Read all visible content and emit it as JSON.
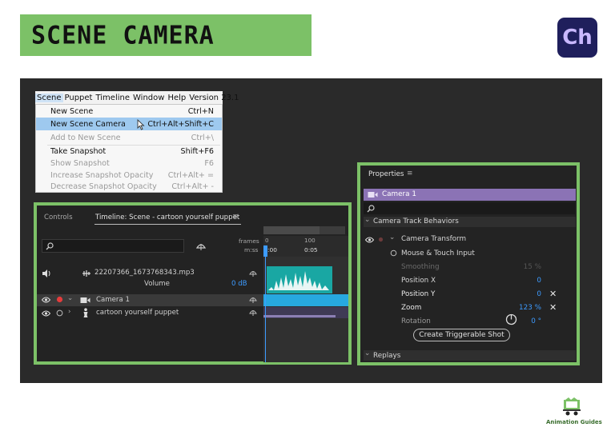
{
  "slide": {
    "title": "SCENE CAMERA",
    "logo_text": "Ch",
    "footer_brand": "Animation Guides",
    "accent_color": "#7cc167"
  },
  "menu_bar": {
    "items": [
      "Scene",
      "Puppet",
      "Timeline",
      "Window",
      "Help",
      "Version 23.1"
    ]
  },
  "scene_menu": {
    "items": [
      {
        "label": "New Scene",
        "shortcut": "Ctrl+N"
      },
      {
        "label": "New Scene Camera",
        "shortcut": "Ctrl+Alt+Shift+C"
      },
      {
        "label": "Add to New Scene",
        "shortcut": "Ctrl+\\"
      },
      {
        "label": "Take Snapshot",
        "shortcut": "Shift+F6"
      },
      {
        "label": "Show Snapshot",
        "shortcut": "F6"
      },
      {
        "label": "Increase Snapshot Opacity",
        "shortcut": "Ctrl+Alt+ ="
      },
      {
        "label": "Decrease Snapshot Opacity",
        "shortcut": "Ctrl+Alt+ -"
      }
    ]
  },
  "timeline": {
    "tab_controls": "Controls",
    "tab_timeline": "Timeline: Scene - cartoon yourself puppet",
    "ruler_units_1": "frames",
    "ruler_units_2": "m:ss",
    "ruler_ticks_frames": [
      "0",
      "100"
    ],
    "ruler_ticks_time": [
      ":00",
      "0:05"
    ],
    "tracks": [
      {
        "name": "22207366_1673768343.mp3",
        "sub_label": "Volume",
        "sub_value": "0 dB"
      },
      {
        "name": "Camera 1"
      },
      {
        "name": "cartoon yourself puppet"
      }
    ]
  },
  "properties": {
    "panel_title": "Properties",
    "selected_item": "Camera 1",
    "section": "Camera Track Behaviors",
    "behavior": "Camera Transform",
    "input_mode": "Mouse & Touch Input",
    "params": [
      {
        "label": "Smoothing",
        "value": "15 %"
      },
      {
        "label": "Position X",
        "value": "0"
      },
      {
        "label": "Position Y",
        "value": "0"
      },
      {
        "label": "Zoom",
        "value": "123 %"
      },
      {
        "label": "Rotation",
        "value": "0 °"
      }
    ],
    "action_button": "Create Triggerable Shot",
    "next_section": "Replays"
  }
}
